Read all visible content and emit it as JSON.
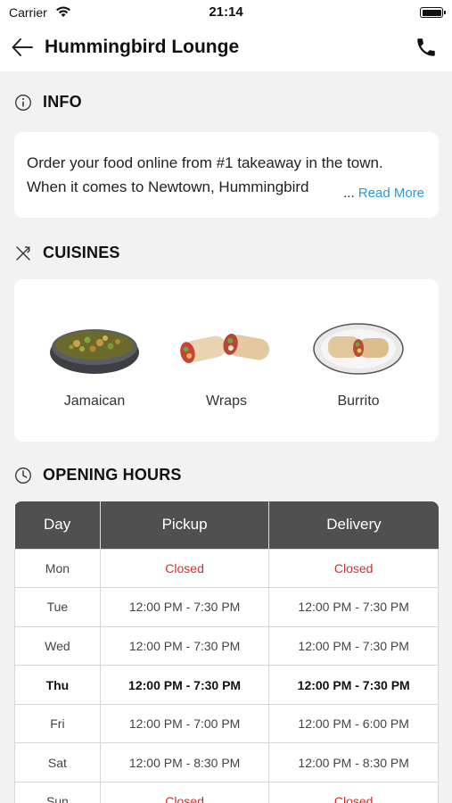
{
  "status_bar": {
    "carrier": "Carrier",
    "time": "21:14"
  },
  "nav": {
    "title": "Hummingbird Lounge",
    "back_icon": "arrow-left-icon",
    "call_icon": "phone-icon"
  },
  "info": {
    "heading": "INFO",
    "text_line1": "Order your food online from #1 takeaway in the town.",
    "text_line2": "When it comes to Newtown, Hummingbird",
    "ellipsis": "...",
    "read_more": "Read More"
  },
  "cuisines": {
    "heading": "CUISINES",
    "items": [
      {
        "label": "Jamaican"
      },
      {
        "label": "Wraps"
      },
      {
        "label": "Burrito"
      }
    ]
  },
  "opening_hours": {
    "heading": "OPENING HOURS",
    "columns": [
      "Day",
      "Pickup",
      "Delivery"
    ],
    "rows": [
      {
        "day": "Mon",
        "pickup": "Closed",
        "delivery": "Closed"
      },
      {
        "day": "Tue",
        "pickup": "12:00 PM - 7:30 PM",
        "delivery": "12:00 PM - 7:30 PM"
      },
      {
        "day": "Wed",
        "pickup": "12:00 PM - 7:30 PM",
        "delivery": "12:00 PM - 7:30 PM"
      },
      {
        "day": "Thu",
        "pickup": "12:00 PM - 7:30 PM",
        "delivery": "12:00 PM - 7:30 PM"
      },
      {
        "day": "Fri",
        "pickup": "12:00 PM - 7:00 PM",
        "delivery": "12:00 PM - 6:00 PM"
      },
      {
        "day": "Sat",
        "pickup": "12:00 PM - 8:30 PM",
        "delivery": "12:00 PM - 8:30 PM"
      },
      {
        "day": "Sun",
        "pickup": "Closed",
        "delivery": "Closed"
      }
    ]
  },
  "colors": {
    "accent_link": "#2a9bd4",
    "closed": "#d32f2f",
    "table_header": "#505050"
  }
}
